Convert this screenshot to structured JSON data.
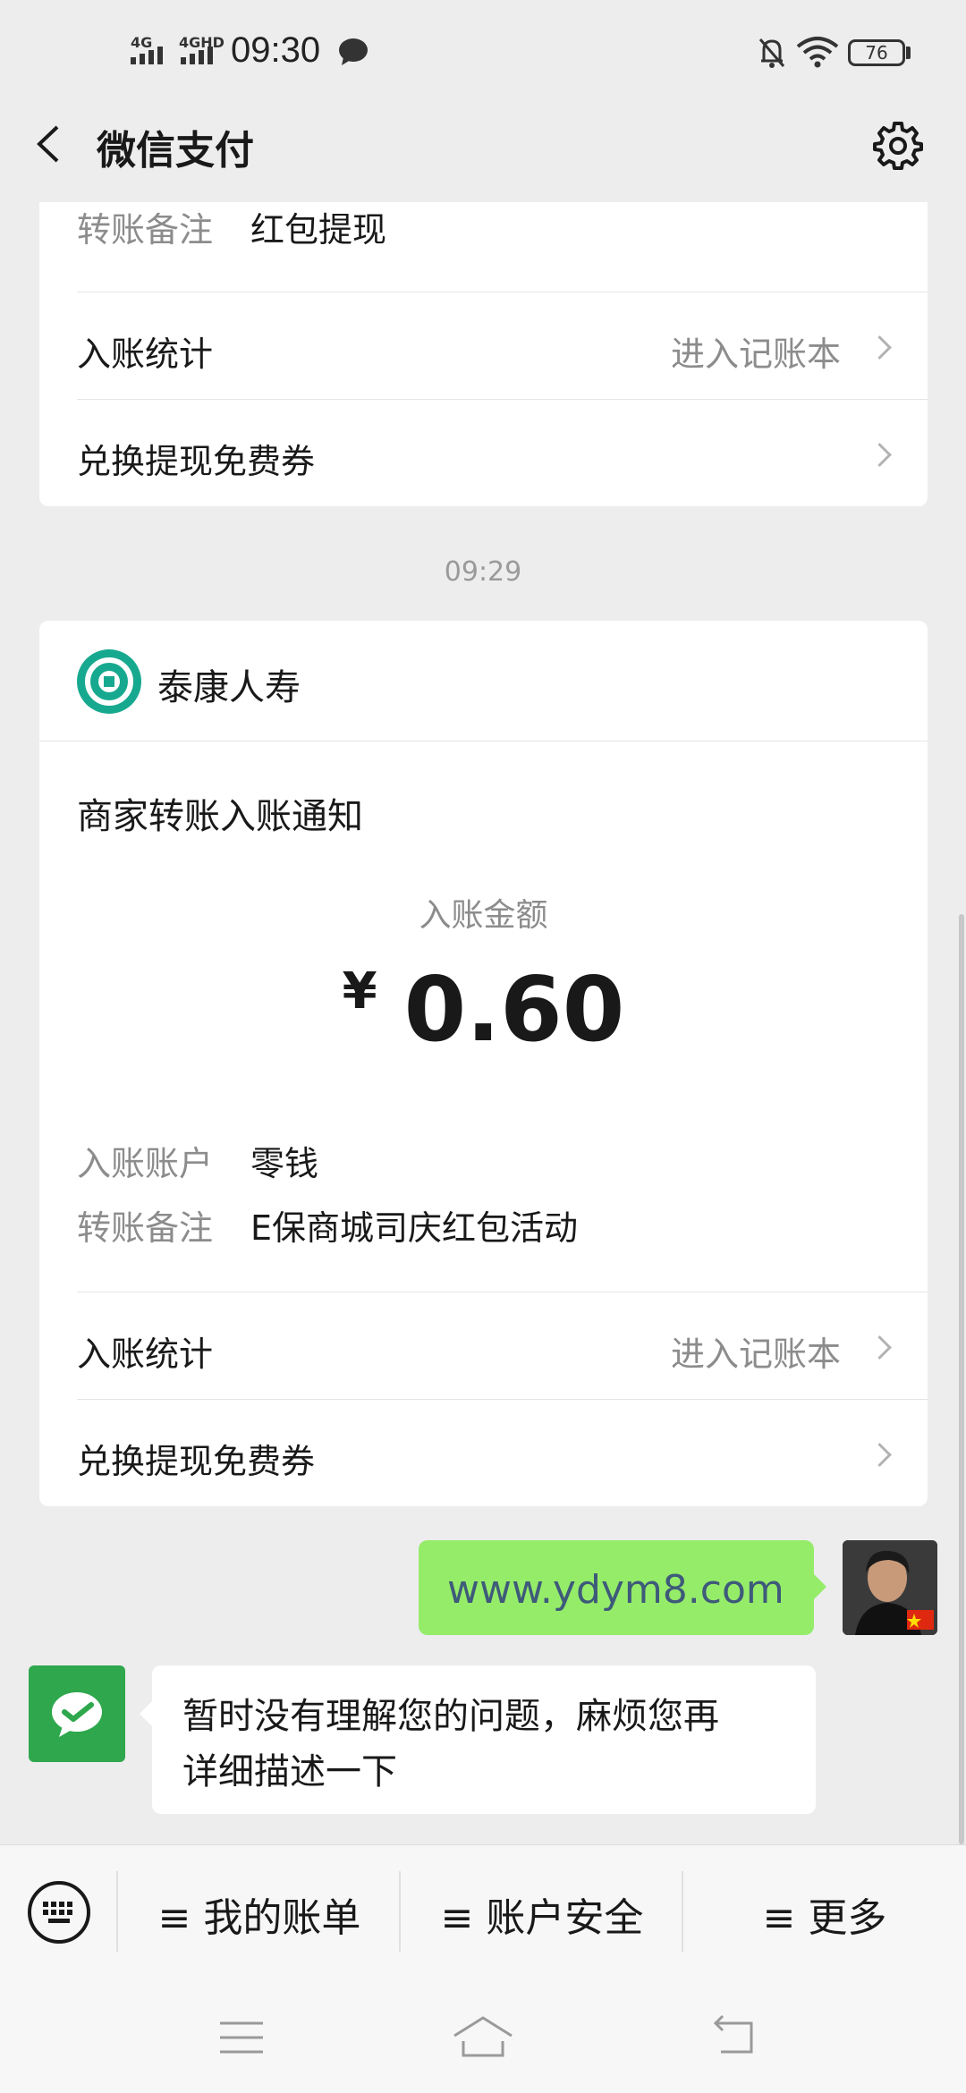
{
  "status": {
    "net1": "4G",
    "net2": "4GHD",
    "time": "09:30",
    "battery": "76"
  },
  "nav": {
    "title": "微信支付"
  },
  "card1": {
    "remark_label": "转账备注",
    "remark_value": "红包提现",
    "stats_label": "入账统计",
    "stats_link": "进入记账本",
    "coupon_label": "兑换提现免费券"
  },
  "timestamp": "09:29",
  "card2": {
    "merchant": "泰康人寿",
    "notice_title": "商家转账入账通知",
    "amount_label": "入账金额",
    "currency": "¥",
    "amount": "0.60",
    "account_label": "入账账户",
    "account_value": "零钱",
    "remark_label": "转账备注",
    "remark_value": "E保商城司庆红包活动",
    "stats_label": "入账统计",
    "stats_link": "进入记账本",
    "coupon_label": "兑换提现免费券"
  },
  "chat": {
    "sent": "www.ydym8.com",
    "reply_line1": "暂时没有理解您的问题，麻烦您再",
    "reply_line2": "详细描述一下"
  },
  "menu": {
    "item1": "≡ 我的账单",
    "item2": "≡ 账户安全",
    "item3": "≡ 更多"
  },
  "colors": {
    "bg": "#ededed",
    "sent_bubble": "#95ec69",
    "wechat_green": "#2ea74d",
    "taikang_teal": "#17a98f"
  }
}
